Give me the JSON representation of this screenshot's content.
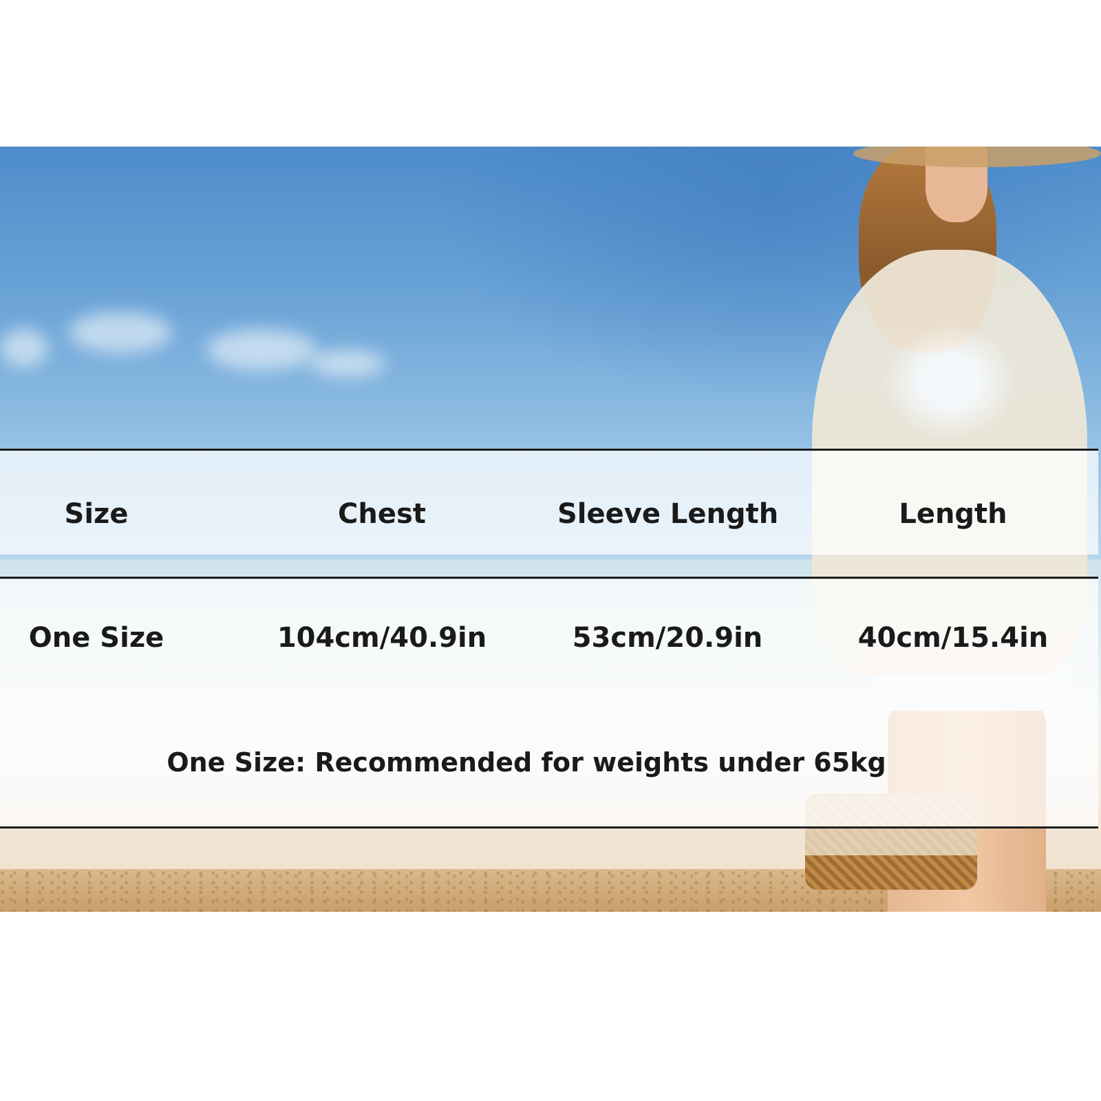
{
  "table": {
    "headers": [
      "Size",
      "Chest",
      "Sleeve Length",
      "Length"
    ],
    "rows": [
      [
        "One Size",
        "104cm/40.9in",
        "53cm/20.9in",
        "40cm/15.4in"
      ]
    ]
  },
  "note": "One Size: Recommended for weights under 65kg",
  "colors": {
    "sky": "#4e8ccb",
    "sand": "#c99e69",
    "text": "#1a1a1a"
  }
}
